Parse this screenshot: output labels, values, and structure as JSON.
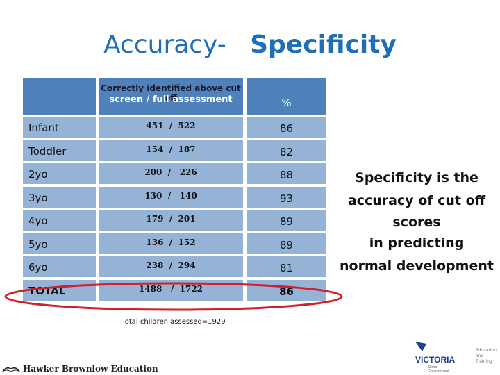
{
  "title": {
    "regular": "Accuracy-",
    "bold": "Specificity"
  },
  "table": {
    "header": {
      "col2_line1": "Correctly identified above cut off",
      "col2_line2": "screen / full assessment",
      "col3": "%"
    },
    "rows": [
      {
        "label": "Infant",
        "value": "451  /  522",
        "pct": "86"
      },
      {
        "label": "Toddler",
        "value": "154  /  187",
        "pct": "82"
      },
      {
        "label": "2yo",
        "value": "200  /   226",
        "pct": "88"
      },
      {
        "label": "3yo",
        "value": "130  /   140",
        "pct": "93"
      },
      {
        "label": "4yo",
        "value": "179  /  201",
        "pct": "89"
      },
      {
        "label": "5yo",
        "value": "136  /  152",
        "pct": "89"
      },
      {
        "label": "6yo",
        "value": "238  /  294",
        "pct": "81"
      },
      {
        "label": "TOTAL",
        "value": "1488   /  1722",
        "pct": "86"
      }
    ],
    "highlight_color": "#d0202a"
  },
  "note": "Total children assessed=1929",
  "side_text": [
    "Specificity is the",
    "accuracy of cut off",
    "scores",
    "in predicting",
    "normal development"
  ],
  "footer": {
    "publisher": "Hawker Brownlow Education",
    "victoria_mark": "VICTORIA",
    "victoria_sub": "State Government",
    "victoria_dept": "Education and Training"
  },
  "colors": {
    "header_bg": "#4f81bd",
    "cell_bg": "#95b3d7",
    "title": "#1f6fb8"
  }
}
